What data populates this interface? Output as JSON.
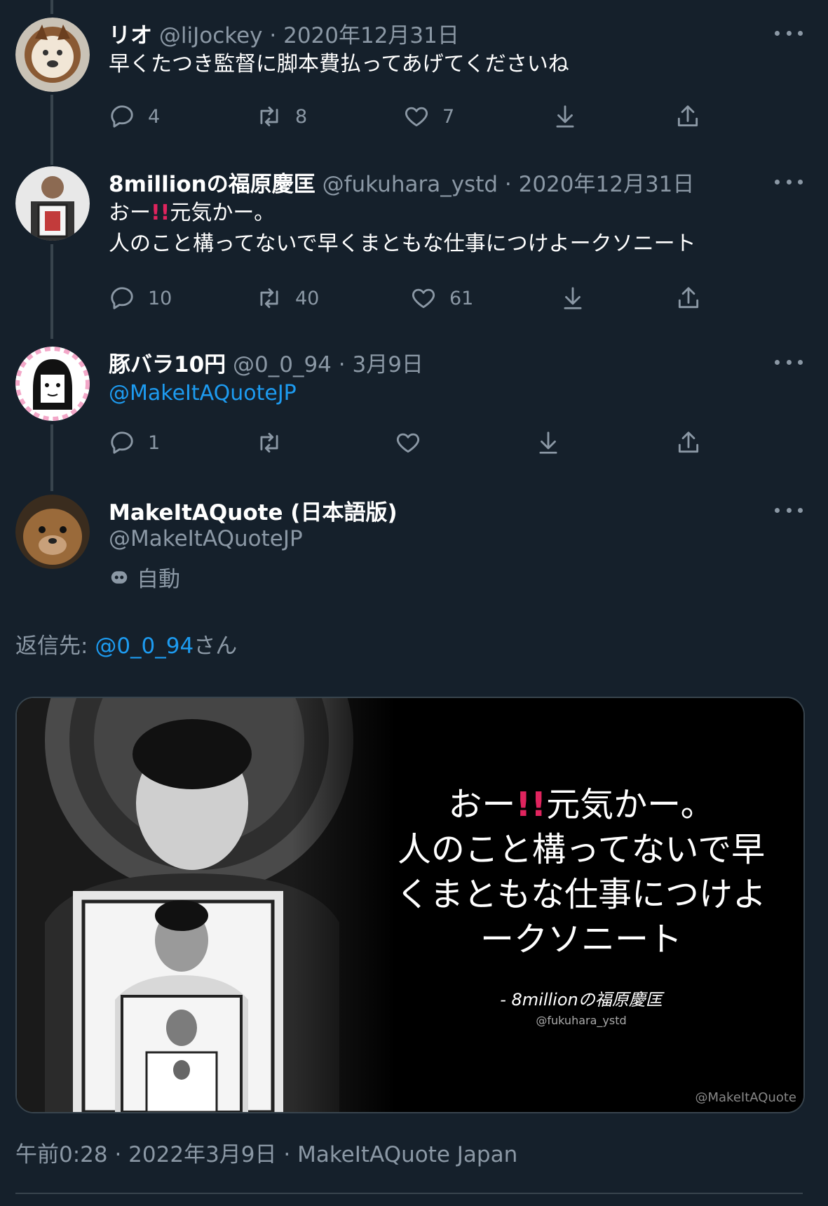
{
  "tweets": [
    {
      "name": "リオ",
      "handle": "@liJockey",
      "date": "2020年12月31日",
      "text_lines": [
        "早くたつき監督に脚本費払ってあげてくださいね"
      ],
      "replies": "4",
      "retweets": "8",
      "likes": "7"
    },
    {
      "name": "8millionの福原慶匡",
      "handle": "@fukuhara_ystd",
      "date": "2020年12月31日",
      "text_lines": [
        "おー",
        "!!",
        "元気かー。",
        "人のこと構ってないで早くまともな仕事につけよークソニート"
      ],
      "replies": "10",
      "retweets": "40",
      "likes": "61"
    },
    {
      "name": "豚バラ10円",
      "handle": "@0_0_94",
      "date": "3月9日",
      "text_lines": [
        "@MakeItAQuoteJP"
      ],
      "replies": "1",
      "retweets": "",
      "likes": ""
    }
  ],
  "main_tweet": {
    "name": "MakeItAQuote (日本語版)",
    "handle": "@MakeItAQuoteJP",
    "automated_label": "自動",
    "reply_to_prefix": "返信先:",
    "reply_to_handle": "@0_0_94",
    "reply_to_suffix": "さん",
    "quote_lines": [
      "おー",
      "!!",
      "元気かー。",
      "人のこと構ってないで早",
      "くまともな仕事につけよ",
      "ークソニート"
    ],
    "quote_author": "- 8millionの福原慶匡",
    "quote_author_handle": "@fukuhara_ystd",
    "watermark": "@MakeItAQuote",
    "timestamp": "午前0:28 · 2022年3月9日 · MakeItAQuote Japan"
  },
  "separator": "·",
  "icons": {
    "reply": "reply-icon",
    "retweet": "retweet-icon",
    "like": "like-icon",
    "download": "download-icon",
    "share": "share-icon",
    "more": "more-icon",
    "bot": "bot-icon"
  },
  "colors": {
    "background": "#15202b",
    "accent": "#1d9bf0",
    "muted": "#8b98a5",
    "divider": "#38444d",
    "exclamation": "#e0245e"
  }
}
